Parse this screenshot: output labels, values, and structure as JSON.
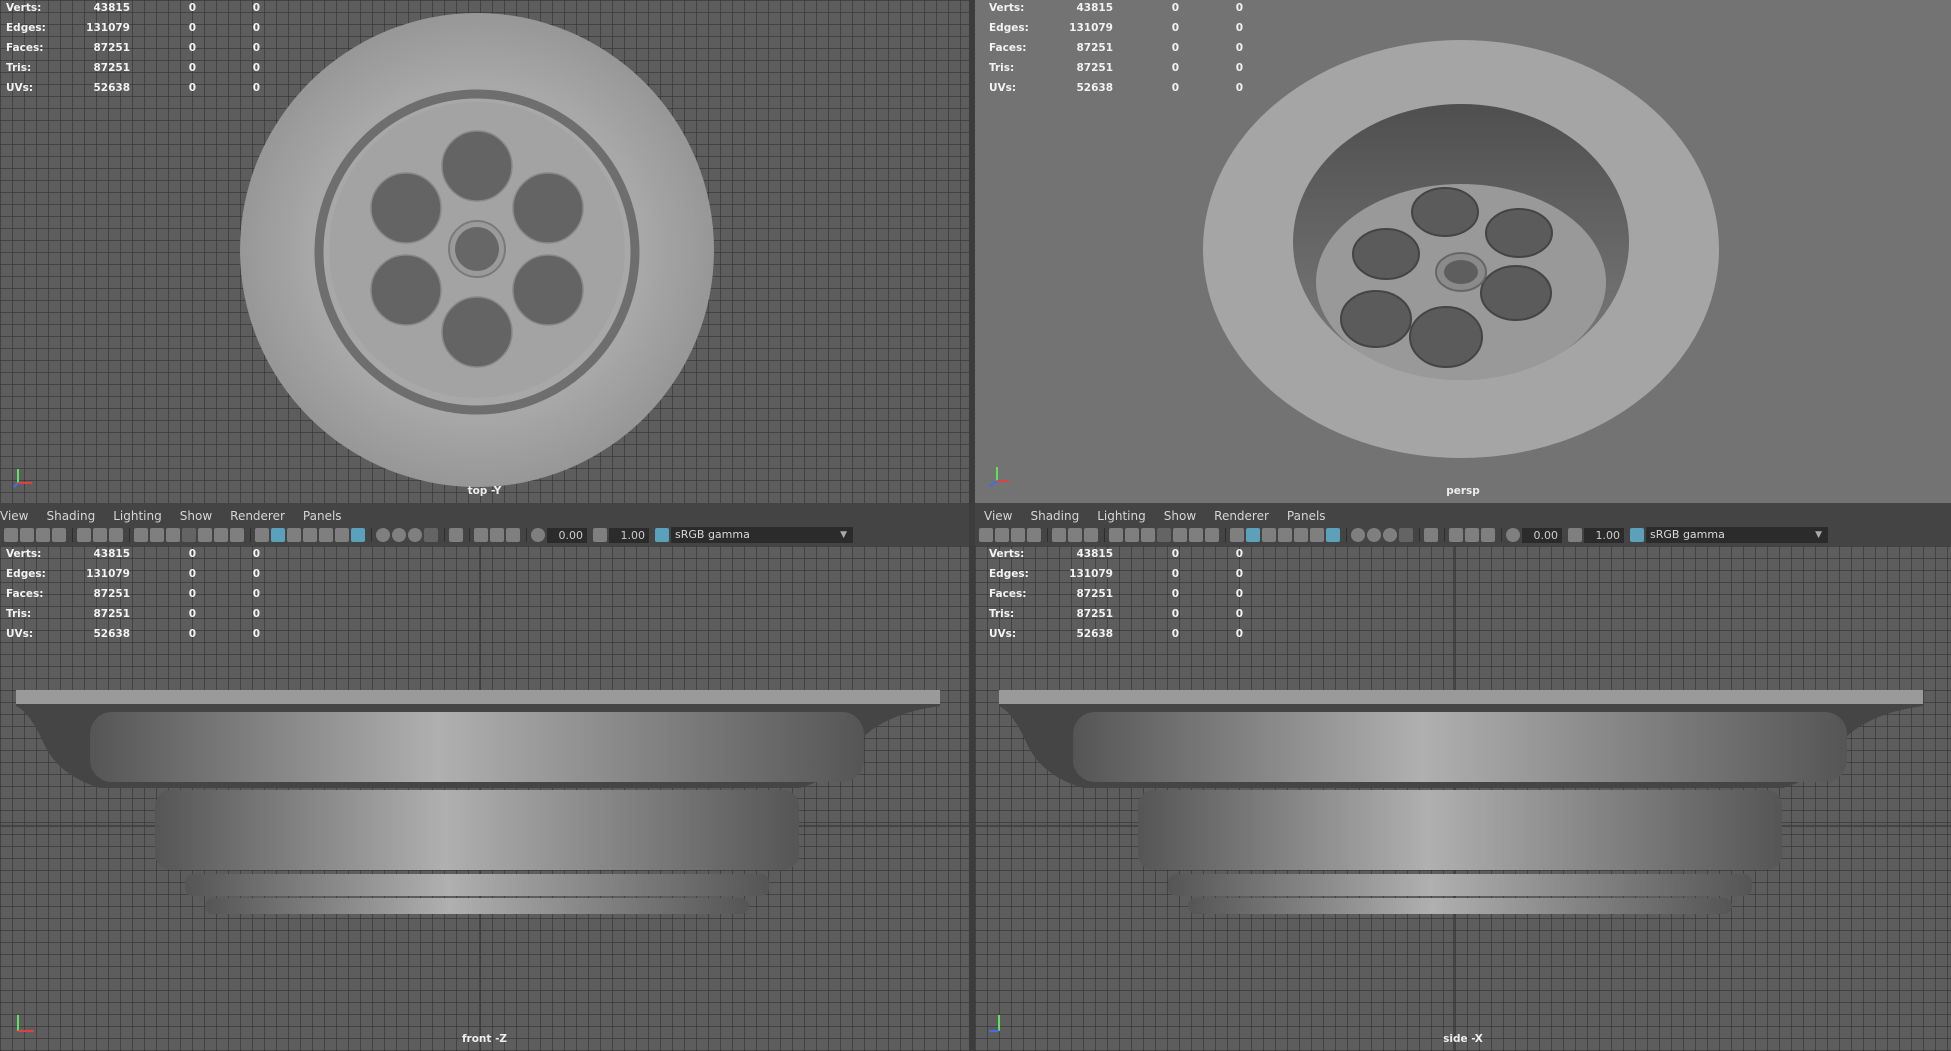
{
  "hud_stats": [
    {
      "label": "Verts:",
      "v1": "43815",
      "v2": "0",
      "v3": "0"
    },
    {
      "label": "Edges:",
      "v1": "131079",
      "v2": "0",
      "v3": "0"
    },
    {
      "label": "Faces:",
      "v1": "87251",
      "v2": "0",
      "v3": "0"
    },
    {
      "label": "Tris:",
      "v1": "87251",
      "v2": "0",
      "v3": "0"
    },
    {
      "label": "UVs:",
      "v1": "52638",
      "v2": "0",
      "v3": "0"
    }
  ],
  "viewports": {
    "top": {
      "camera": "top -Y"
    },
    "persp": {
      "camera": "persp"
    },
    "front": {
      "camera": "front -Z"
    },
    "side": {
      "camera": "side -X"
    }
  },
  "panel_menu": [
    "View",
    "Shading",
    "Lighting",
    "Show",
    "Renderer",
    "Panels"
  ],
  "toolbar": {
    "exposure": "0.00",
    "gamma": "1.00",
    "color_space": "sRGB gamma"
  },
  "colors": {
    "accent": "#5fb2d1",
    "viewport_grid": "#5d5d5d",
    "persp_bg": "#737373",
    "panel": "#444444"
  }
}
